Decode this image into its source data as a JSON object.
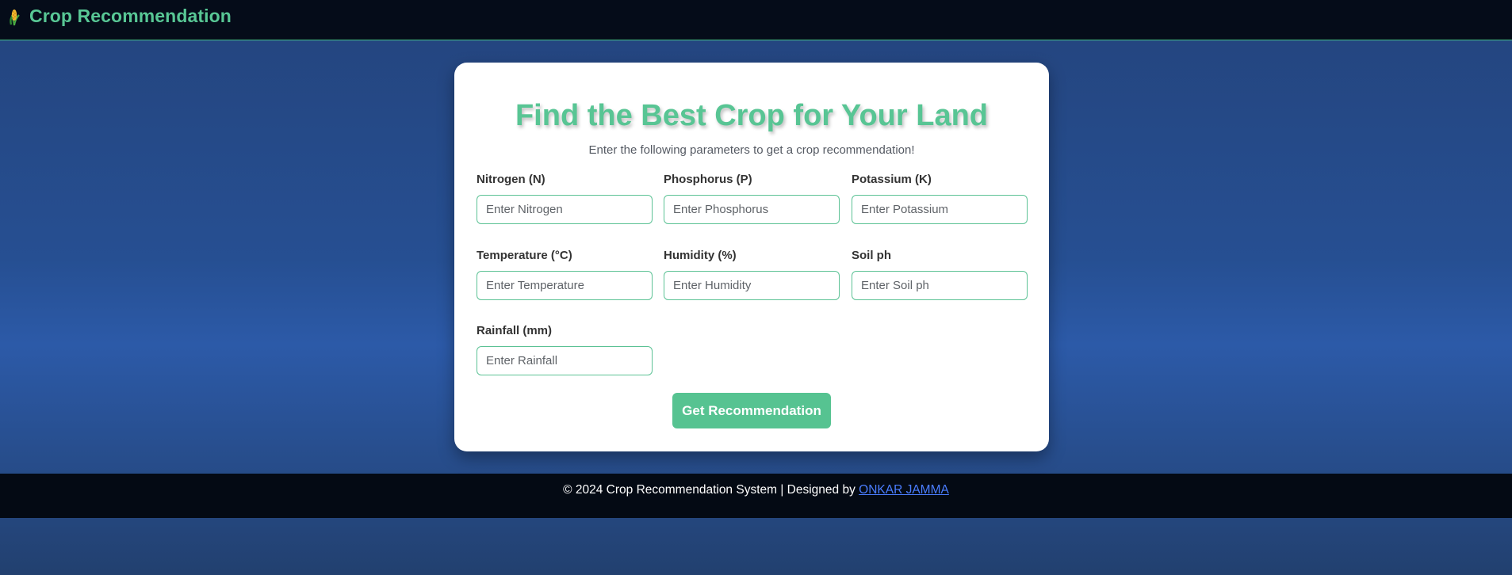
{
  "navbar": {
    "title": "Crop Recommendation",
    "icon": "corn-icon"
  },
  "form": {
    "heading": "Find the Best Crop for Your Land",
    "subheading": "Enter the following parameters to get a crop recommendation!",
    "fields": [
      {
        "label": "Nitrogen (N)",
        "placeholder": "Enter Nitrogen",
        "value": ""
      },
      {
        "label": "Phosphorus (P)",
        "placeholder": "Enter Phosphorus",
        "value": ""
      },
      {
        "label": "Potassium (K)",
        "placeholder": "Enter Potassium",
        "value": ""
      },
      {
        "label": "Temperature (°C)",
        "placeholder": "Enter Temperature",
        "value": ""
      },
      {
        "label": "Humidity (%)",
        "placeholder": "Enter Humidity",
        "value": ""
      },
      {
        "label": "Soil ph",
        "placeholder": "Enter Soil ph",
        "value": ""
      },
      {
        "label": "Rainfall (mm)",
        "placeholder": "Enter Rainfall",
        "value": ""
      }
    ],
    "submit_label": "Get Recommendation"
  },
  "footer": {
    "text": "© 2024 Crop Recommendation System | Designed by ",
    "link_text": "ONKAR JAMMA"
  },
  "colors": {
    "accent": "#58c795",
    "navbar_bg": "#050c19",
    "page_bg": "#264f92",
    "link": "#4a7dff"
  }
}
